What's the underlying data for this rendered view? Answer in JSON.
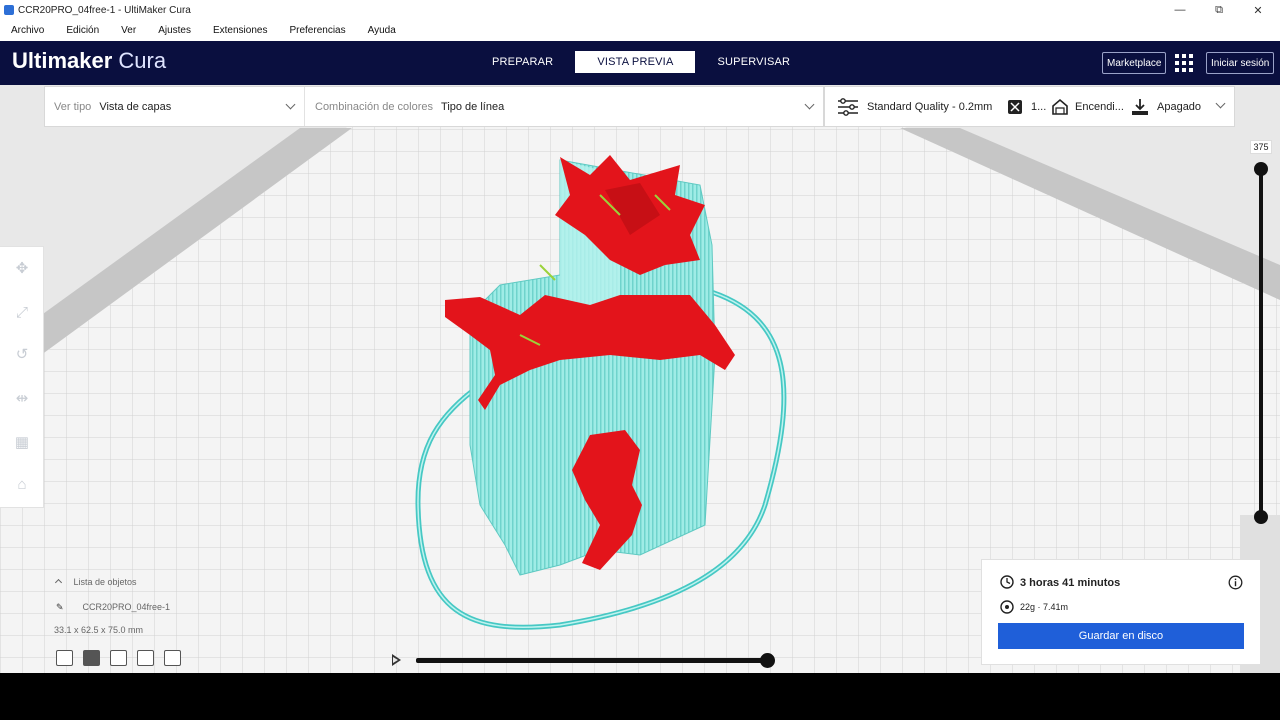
{
  "window": {
    "title": "CCR20PRO_04free-1 - UltiMaker Cura",
    "minimize": "—",
    "maximize": "⧉",
    "close": "✕"
  },
  "menu": [
    "Archivo",
    "Edición",
    "Ver",
    "Ajustes",
    "Extensiones",
    "Preferencias",
    "Ayuda"
  ],
  "brand": {
    "bold": "Ultimaker",
    "light": "Cura"
  },
  "stages": [
    {
      "label": "PREPARAR",
      "active": false
    },
    {
      "label": "VISTA PREVIA",
      "active": true
    },
    {
      "label": "SUPERVISAR",
      "active": false
    }
  ],
  "header_buttons": {
    "marketplace": "Marketplace",
    "signin": "Iniciar sesión"
  },
  "viewbar": {
    "view_type_label": "Ver tipo",
    "view_type_value": "Vista de capas",
    "color_scheme_label": "Combinación de colores",
    "color_scheme_value": "Tipo de línea"
  },
  "printbar": {
    "quality": "Standard Quality - 0.2mm",
    "infill": "1...",
    "support": "Encendi...",
    "adhesion": "Apagado"
  },
  "icons": {
    "tools": [
      "move-icon",
      "scale-icon",
      "rotate-icon",
      "mirror-icon",
      "per-model-settings-icon",
      "support-blocker-icon"
    ],
    "tool_glyphs": [
      "✥",
      "⤢",
      "↺",
      "⇹",
      "▦",
      "⌂"
    ]
  },
  "layer_slider": {
    "current": "375"
  },
  "object_list": {
    "title": "Lista de objetos",
    "object_name": "CCR20PRO_04free-1",
    "dimensions": "33.1 x 62.5 x 75.0 mm"
  },
  "print_info": {
    "time": "3 horas 41 minutos",
    "material": "22g · 7.41m",
    "save_label": "Guardar en disco"
  },
  "colors": {
    "header": "#0a0f3f",
    "accent": "#1f5fd9",
    "wall": "#e3141b",
    "support": "#7fe3dc",
    "skirt": "#46c8c4"
  }
}
